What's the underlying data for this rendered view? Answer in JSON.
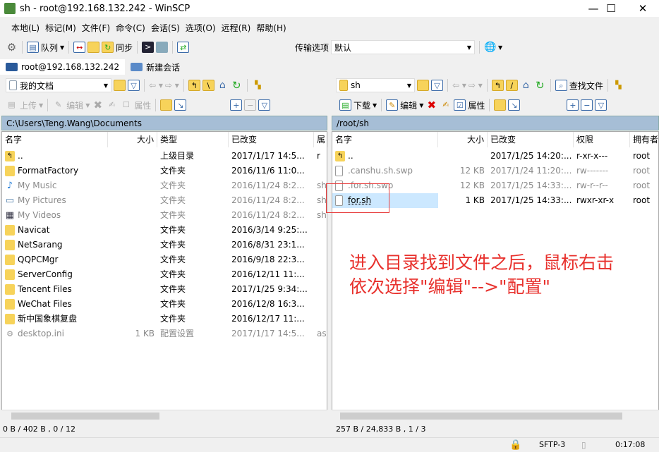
{
  "window": {
    "title": "sh - root@192.168.132.242 - WinSCP",
    "min": "—",
    "max": "☐",
    "close": "✕"
  },
  "menu": [
    "本地(L)",
    "标记(M)",
    "文件(F)",
    "命令(C)",
    "会话(S)",
    "选项(O)",
    "远程(R)",
    "帮助(H)"
  ],
  "toolbar": {
    "queue": "队列",
    "sync": "同步",
    "transfer_label": "传输选项",
    "transfer_value": "默认"
  },
  "tabs": [
    {
      "label": "root@192.168.132.242"
    },
    {
      "label": "新建会话"
    }
  ],
  "local": {
    "location": "我的文档",
    "upload": "上传",
    "edit": "编辑",
    "props": "属性",
    "path": "C:\\Users\\Teng.Wang\\Documents",
    "columns": [
      "名字",
      "大小",
      "类型",
      "已改变",
      "属"
    ],
    "rows": [
      {
        "icon": "parent-folder",
        "name": "..",
        "size": "",
        "type": "上级目录",
        "modified": "2017/1/17  14:5...",
        "attr": "r",
        "dim": false
      },
      {
        "icon": "folder",
        "name": "FormatFactory",
        "size": "",
        "type": "文件夹",
        "modified": "2016/11/6  11:0...",
        "attr": "",
        "dim": false
      },
      {
        "icon": "music",
        "name": "My Music",
        "size": "",
        "type": "文件夹",
        "modified": "2016/11/24  8:2...",
        "attr": "sh",
        "dim": true
      },
      {
        "icon": "pictures",
        "name": "My Pictures",
        "size": "",
        "type": "文件夹",
        "modified": "2016/11/24  8:2...",
        "attr": "sh",
        "dim": true
      },
      {
        "icon": "videos",
        "name": "My Videos",
        "size": "",
        "type": "文件夹",
        "modified": "2016/11/24  8:2...",
        "attr": "sh",
        "dim": true
      },
      {
        "icon": "folder",
        "name": "Navicat",
        "size": "",
        "type": "文件夹",
        "modified": "2016/3/14  9:25:...",
        "attr": "",
        "dim": false
      },
      {
        "icon": "folder",
        "name": "NetSarang",
        "size": "",
        "type": "文件夹",
        "modified": "2016/8/31  23:1...",
        "attr": "",
        "dim": false
      },
      {
        "icon": "folder",
        "name": "QQPCMgr",
        "size": "",
        "type": "文件夹",
        "modified": "2016/9/18  22:3...",
        "attr": "",
        "dim": false
      },
      {
        "icon": "folder",
        "name": "ServerConfig",
        "size": "",
        "type": "文件夹",
        "modified": "2016/12/11  11:...",
        "attr": "",
        "dim": false
      },
      {
        "icon": "folder",
        "name": "Tencent Files",
        "size": "",
        "type": "文件夹",
        "modified": "2017/1/25  9:34:...",
        "attr": "",
        "dim": false
      },
      {
        "icon": "folder",
        "name": "WeChat Files",
        "size": "",
        "type": "文件夹",
        "modified": "2016/12/8  16:3...",
        "attr": "",
        "dim": false
      },
      {
        "icon": "folder",
        "name": "新中国象棋复盘",
        "size": "",
        "type": "文件夹",
        "modified": "2016/12/17  11:...",
        "attr": "",
        "dim": false
      },
      {
        "icon": "settings-file",
        "name": "desktop.ini",
        "size": "1 KB",
        "type": "配置设置",
        "modified": "2017/1/17  14:5...",
        "attr": "as",
        "dim": true
      }
    ],
    "status": "0 B / 402 B , 0 / 12"
  },
  "remote": {
    "location": "sh",
    "download": "下载",
    "edit": "编辑",
    "props": "属性",
    "find": "查找文件",
    "path": "/root/sh",
    "columns": [
      "名字",
      "大小",
      "已改变",
      "权限",
      "拥有者"
    ],
    "rows": [
      {
        "icon": "parent-folder",
        "name": "..",
        "size": "",
        "modified": "2017/1/25 14:20:...",
        "perm": "r-xr-x---",
        "owner": "root",
        "dim": false,
        "selected": false
      },
      {
        "icon": "file",
        "name": ".canshu.sh.swp",
        "size": "12 KB",
        "modified": "2017/1/24 11:20:...",
        "perm": "rw-------",
        "owner": "root",
        "dim": true,
        "selected": false
      },
      {
        "icon": "file",
        "name": ".for.sh.swp",
        "size": "12 KB",
        "modified": "2017/1/25 14:33:...",
        "perm": "rw-r--r--",
        "owner": "root",
        "dim": true,
        "selected": false
      },
      {
        "icon": "file",
        "name": "for.sh",
        "size": "1 KB",
        "modified": "2017/1/25 14:33:...",
        "perm": "rwxr-xr-x",
        "owner": "root",
        "dim": false,
        "selected": true
      }
    ],
    "status": "257 B / 24,833 B , 1 / 3"
  },
  "statusbar": {
    "protocol": "SFTP-3",
    "time": "0:17:08"
  },
  "annotation": {
    "line1": "进入目录找到文件之后，鼠标右击",
    "line2": "依次选择\"编辑\"-->\"配置\"",
    "color": "#e8312d"
  }
}
